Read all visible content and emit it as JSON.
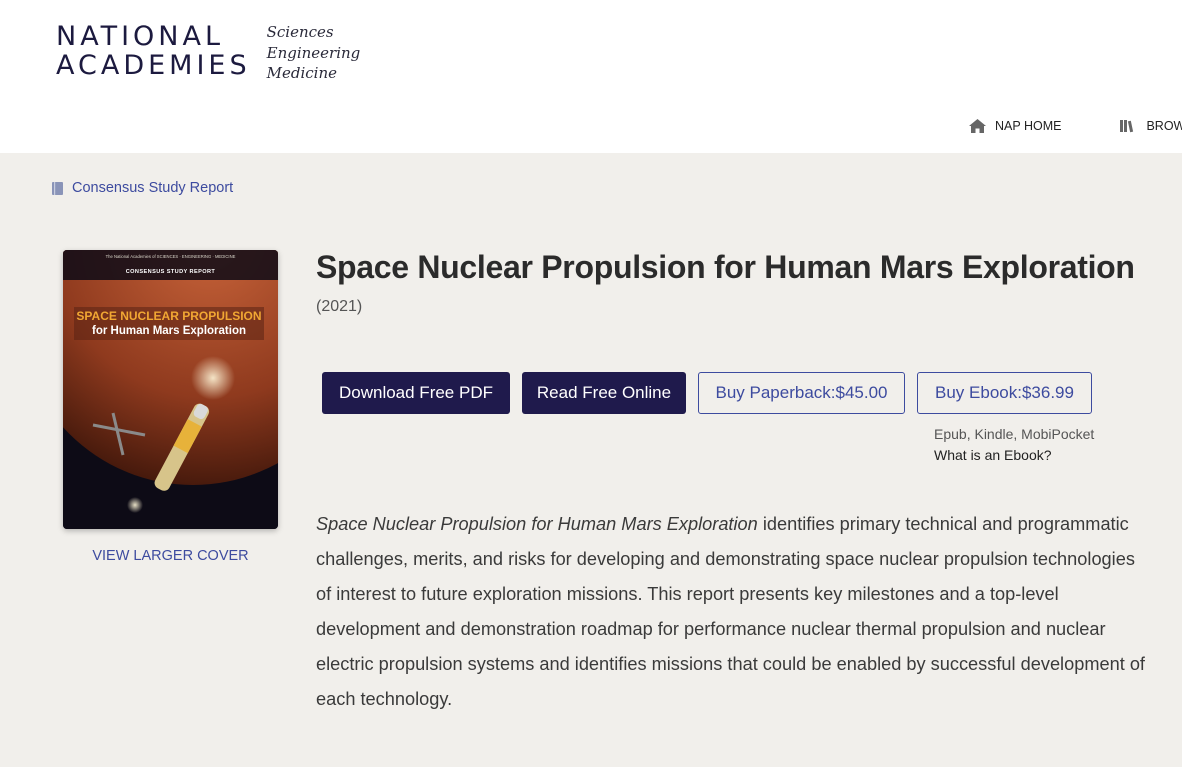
{
  "header": {
    "logo_line1": "NATIONAL",
    "logo_line2": "ACADEMIES",
    "logo_sub": [
      "Sciences",
      "Engineering",
      "Medicine"
    ],
    "nav": [
      {
        "label": "NAP HOME",
        "icon": "home-icon"
      },
      {
        "label": "BROW",
        "icon": "books-icon"
      }
    ]
  },
  "breadcrumb": {
    "label": "Consensus Study Report",
    "icon": "book-icon"
  },
  "cover": {
    "top_text": "The National Academies of SCIENCES · ENGINEERING · MEDICINE",
    "series": "CONSENSUS STUDY REPORT",
    "title_line1": "SPACE NUCLEAR PROPULSION",
    "title_line2": "for Human Mars Exploration",
    "view_larger": "VIEW LARGER COVER"
  },
  "book": {
    "title": "Space Nuclear Propulsion for Human Mars Exploration",
    "year": "(2021)"
  },
  "actions": {
    "download_pdf": "Download Free PDF",
    "read_online": "Read Free Online",
    "buy_paperback": "Buy Paperback:$45.00",
    "buy_ebook": "Buy Ebook:$36.99",
    "ebook_formats": "Epub, Kindle, MobiPocket",
    "ebook_help": "What is an Ebook?"
  },
  "description": {
    "title_italic": "Space Nuclear Propulsion for Human Mars Exploration",
    "text": " identifies primary technical and programmatic challenges, merits, and risks for developing and demonstrating space nuclear propulsion technologies of interest to future exploration missions. This report presents key milestones and a top-level development and demonstration roadmap for performance nuclear thermal propulsion and nuclear electric propulsion systems and identifies missions that could be enabled by successful development of each technology."
  },
  "colors": {
    "brand_dark": "#1f1a4c",
    "link_blue": "#3d4b9f",
    "page_bg": "#f1efeb"
  }
}
